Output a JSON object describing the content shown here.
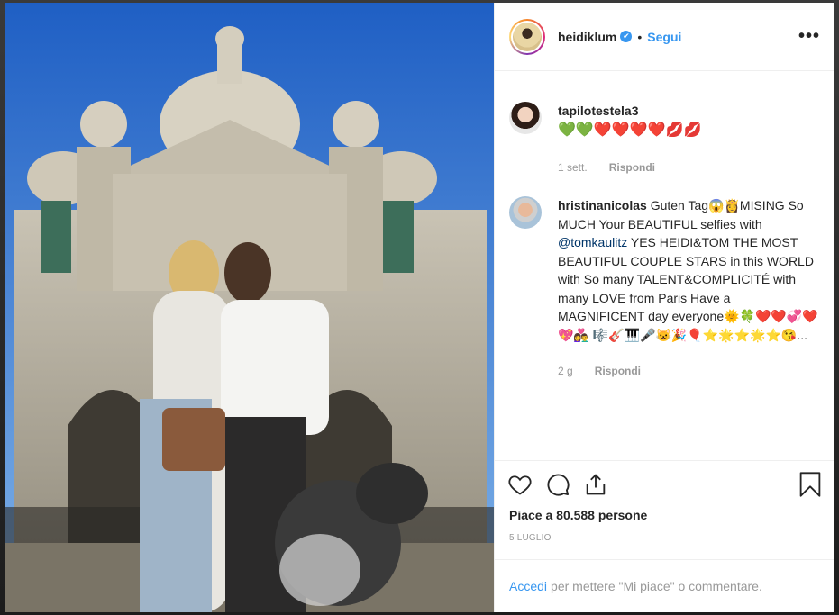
{
  "post": {
    "username": "heidiklum",
    "follow_label": "Segui",
    "more_label": "•••",
    "verified_glyph": "✔"
  },
  "comments": [
    {
      "username": "tapilotestela3",
      "text": "",
      "emojis": "💚💚❤️❤️❤️❤️💋💋",
      "time": "1 sett.",
      "reply_label": "Rispondi"
    },
    {
      "username": "hristinanicolas",
      "text_before": " Guten Tag😱👸MISING So MUCH Your BEAUTIFUL selfies with ",
      "mention": "@tomkaulitz",
      "text_after": " YES HEIDI&TOM THE MOST BEAUTIFUL COUPLE STARS in this WORLD with So many TALENT&COMPLICITÉ with many LOVE from Paris Have a MAGNIFICENT day everyone🌞🍀❤️❤️💞❤️💖👩‍❤️‍👨 🎼🎸🎹🎤😺🎉🎈⭐🌟⭐🌟⭐😘...",
      "time": "2 g",
      "reply_label": "Rispondi"
    }
  ],
  "likes_text": "Piace a 80.588 persone",
  "date_text": "5 LUGLIO",
  "login": {
    "link": "Accedi",
    "rest": "per mettere \"Mi piace\" o commentare."
  },
  "colors": {
    "accent": "#3897f0",
    "text": "#262626",
    "muted": "#999999"
  },
  "icons": [
    "heart-icon",
    "comment-icon",
    "share-icon",
    "bookmark-icon"
  ]
}
